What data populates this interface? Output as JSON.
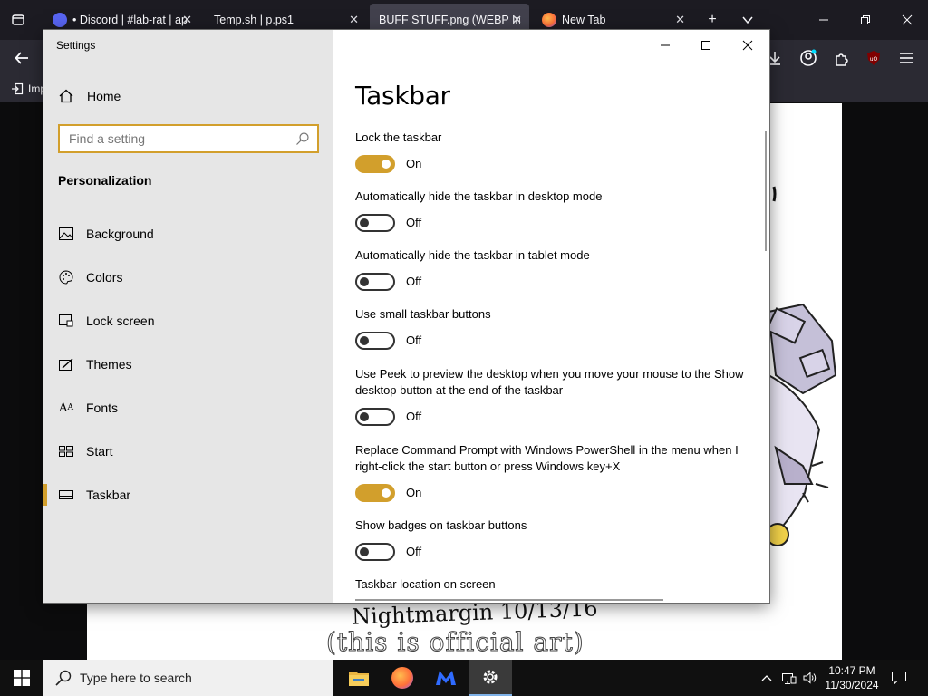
{
  "browser": {
    "tabs": [
      {
        "title": "• Discord | #lab-rat | ap",
        "active": false
      },
      {
        "title": "Temp.sh | p.ps1",
        "active": false
      },
      {
        "title": "BUFF STUFF.png (WEBP Im",
        "active": true
      },
      {
        "title": "New Tab",
        "active": false
      }
    ],
    "bookmark_label": "Imp"
  },
  "artwork": {
    "text_line1": "Nightmargin  10/13/16",
    "text_line2": "(this is official art)"
  },
  "settings": {
    "window_title": "Settings",
    "home_label": "Home",
    "search_placeholder": "Find a setting",
    "section_label": "Personalization",
    "nav": [
      {
        "label": "Background",
        "icon": "picture-icon"
      },
      {
        "label": "Colors",
        "icon": "palette-icon"
      },
      {
        "label": "Lock screen",
        "icon": "lock-screen-icon"
      },
      {
        "label": "Themes",
        "icon": "themes-icon"
      },
      {
        "label": "Fonts",
        "icon": "fonts-icon"
      },
      {
        "label": "Start",
        "icon": "start-icon"
      },
      {
        "label": "Taskbar",
        "icon": "taskbar-icon",
        "selected": true
      }
    ],
    "page_title": "Taskbar",
    "options": [
      {
        "label": "Lock the taskbar",
        "state": "On"
      },
      {
        "label": "Automatically hide the taskbar in desktop mode",
        "state": "Off"
      },
      {
        "label": "Automatically hide the taskbar in tablet mode",
        "state": "Off"
      },
      {
        "label": "Use small taskbar buttons",
        "state": "Off"
      },
      {
        "label": "Use Peek to preview the desktop when you move your mouse to the Show desktop button at the end of the taskbar",
        "state": "Off"
      },
      {
        "label": "Replace Command Prompt with Windows PowerShell in the menu when I right-click the start button or press Windows key+X",
        "state": "On"
      },
      {
        "label": "Show badges on taskbar buttons",
        "state": "Off"
      }
    ],
    "location_label": "Taskbar location on screen",
    "accent_color": "#d29f2c"
  },
  "taskbar": {
    "search_text": "Type here to search",
    "time": "10:47 PM",
    "date": "11/30/2024"
  }
}
